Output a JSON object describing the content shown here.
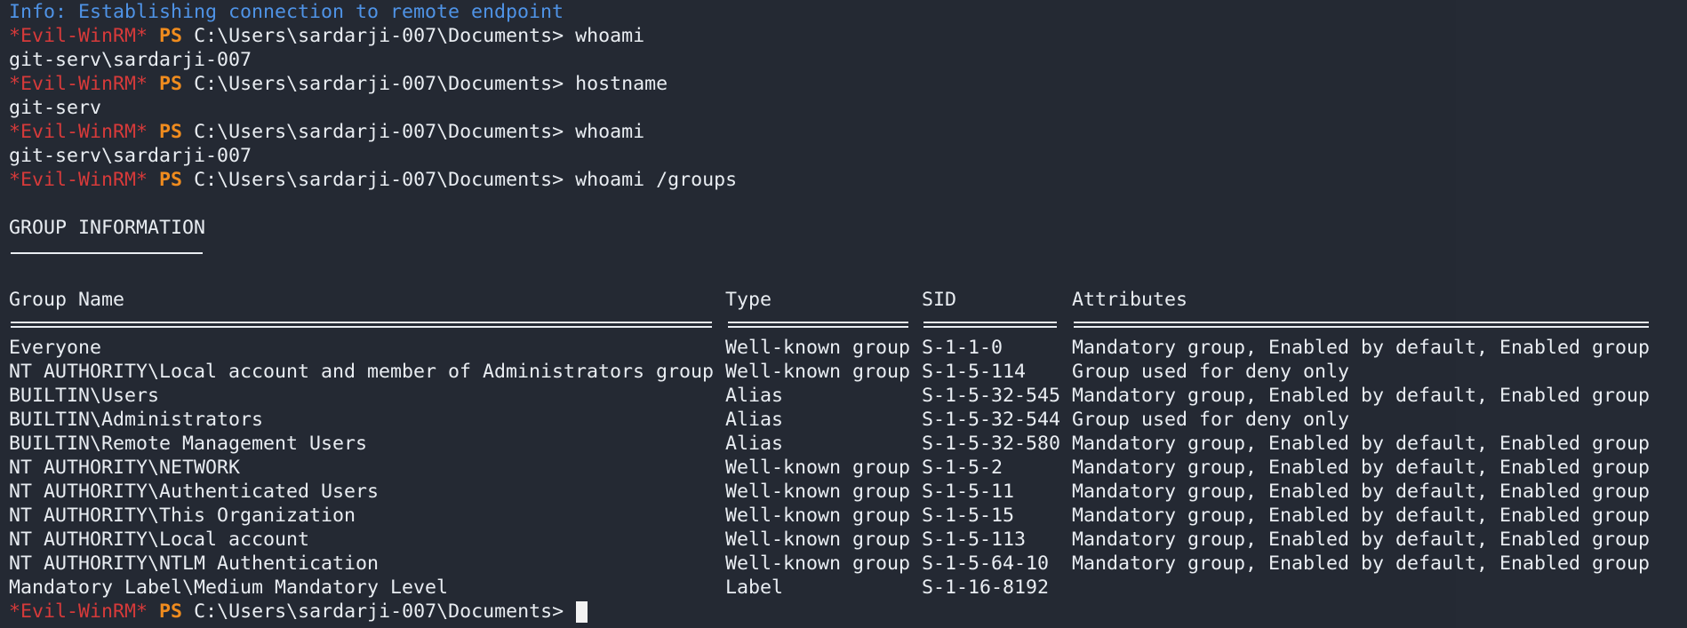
{
  "terminal": {
    "info_line": "Info: Establishing connection to remote endpoint",
    "prompt": {
      "shell_tag": "*Evil-WinRM*",
      "ps_label": "PS",
      "cwd": "C:\\Users\\sardarji-007\\Documents>"
    },
    "commands": [
      {
        "command": "whoami",
        "output": "git-serv\\sardarji-007"
      },
      {
        "command": "hostname",
        "output": "git-serv"
      },
      {
        "command": "whoami",
        "output": "git-serv\\sardarji-007"
      },
      {
        "command": "whoami /groups",
        "output": ""
      }
    ],
    "section_title": "GROUP INFORMATION",
    "table": {
      "headers": {
        "group_name": "Group Name",
        "type": "Type",
        "sid": "SID",
        "attributes": "Attributes"
      },
      "rows": [
        {
          "group_name": "Everyone",
          "type": "Well-known group",
          "sid": "S-1-1-0",
          "attributes": "Mandatory group, Enabled by default, Enabled group"
        },
        {
          "group_name": "NT AUTHORITY\\Local account and member of Administrators group",
          "type": "Well-known group",
          "sid": "S-1-5-114",
          "attributes": "Group used for deny only"
        },
        {
          "group_name": "BUILTIN\\Users",
          "type": "Alias",
          "sid": "S-1-5-32-545",
          "attributes": "Mandatory group, Enabled by default, Enabled group"
        },
        {
          "group_name": "BUILTIN\\Administrators",
          "type": "Alias",
          "sid": "S-1-5-32-544",
          "attributes": "Group used for deny only"
        },
        {
          "group_name": "BUILTIN\\Remote Management Users",
          "type": "Alias",
          "sid": "S-1-5-32-580",
          "attributes": "Mandatory group, Enabled by default, Enabled group"
        },
        {
          "group_name": "NT AUTHORITY\\NETWORK",
          "type": "Well-known group",
          "sid": "S-1-5-2",
          "attributes": "Mandatory group, Enabled by default, Enabled group"
        },
        {
          "group_name": "NT AUTHORITY\\Authenticated Users",
          "type": "Well-known group",
          "sid": "S-1-5-11",
          "attributes": "Mandatory group, Enabled by default, Enabled group"
        },
        {
          "group_name": "NT AUTHORITY\\This Organization",
          "type": "Well-known group",
          "sid": "S-1-5-15",
          "attributes": "Mandatory group, Enabled by default, Enabled group"
        },
        {
          "group_name": "NT AUTHORITY\\Local account",
          "type": "Well-known group",
          "sid": "S-1-5-113",
          "attributes": "Mandatory group, Enabled by default, Enabled group"
        },
        {
          "group_name": "NT AUTHORITY\\NTLM Authentication",
          "type": "Well-known group",
          "sid": "S-1-5-64-10",
          "attributes": "Mandatory group, Enabled by default, Enabled group"
        },
        {
          "group_name": "Mandatory Label\\Medium Mandatory Level",
          "type": "Label",
          "sid": "S-1-16-8192",
          "attributes": ""
        }
      ]
    },
    "colors": {
      "background": "#242933",
      "info": "#4f93e6",
      "shell_tag": "#d63a3a",
      "ps_label": "#f08c1e",
      "text": "#e9edf2"
    }
  }
}
